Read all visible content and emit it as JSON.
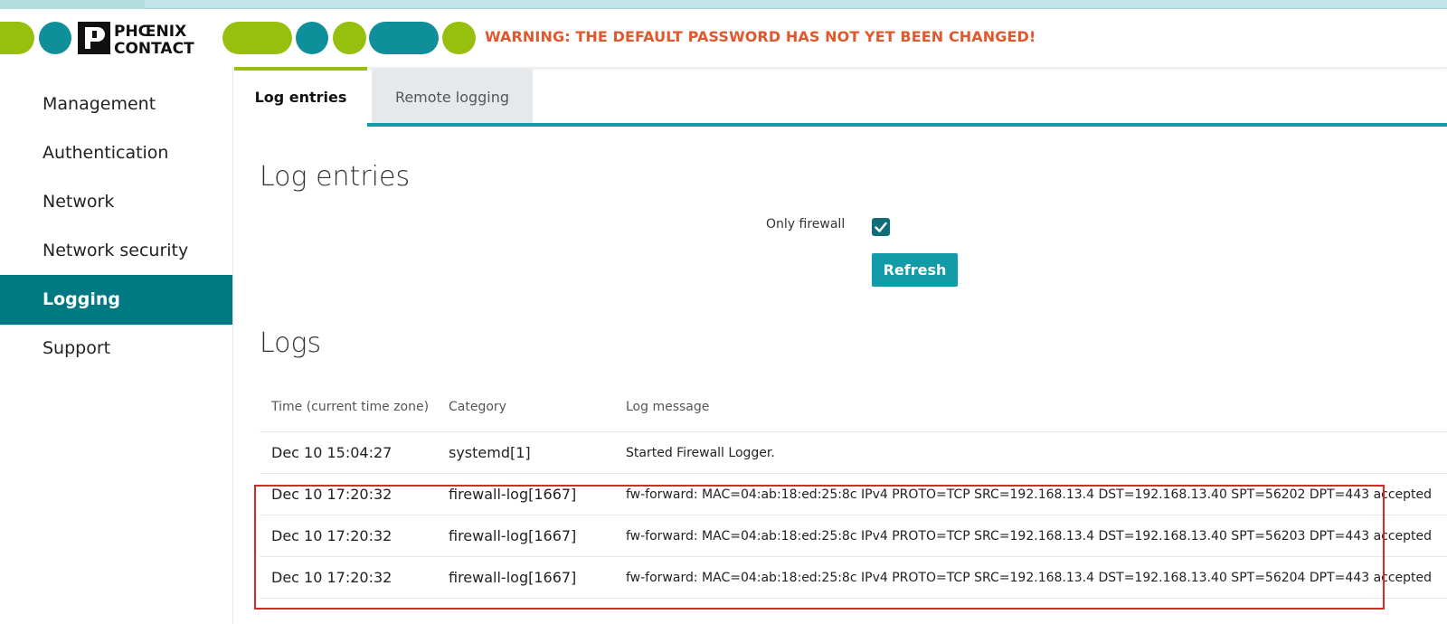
{
  "header": {
    "logo_text": "PHŒNIX CONTACT",
    "warning": "WARNING: THE DEFAULT PASSWORD HAS NOT YET BEEN CHANGED!",
    "colors": {
      "green": "#97bf0d",
      "teal": "#0f8f9a",
      "warning": "#e2572c"
    }
  },
  "sidebar": {
    "items": [
      {
        "label": "Management"
      },
      {
        "label": "Authentication"
      },
      {
        "label": "Network"
      },
      {
        "label": "Network security"
      },
      {
        "label": "Logging",
        "active": true
      },
      {
        "label": "Support"
      }
    ],
    "active_color": "#007983"
  },
  "tabs": [
    {
      "label": "Log entries",
      "active": true
    },
    {
      "label": "Remote logging",
      "active": false
    }
  ],
  "log_entries": {
    "title": "Log entries",
    "only_firewall_label": "Only firewall",
    "only_firewall_checked": true,
    "refresh_label": "Refresh"
  },
  "logs": {
    "title": "Logs",
    "columns": [
      "Time (current time zone)",
      "Category",
      "Log message"
    ],
    "rows": [
      {
        "time": "Dec 10 15:04:27",
        "category": "systemd[1]",
        "message": "Started Firewall Logger."
      },
      {
        "time": "Dec 10 17:20:32",
        "category": "firewall-log[1667]",
        "message": "fw-forward: MAC=04:ab:18:ed:25:8c IPv4 PROTO=TCP SRC=192.168.13.4 DST=192.168.13.40 SPT=56202 DPT=443 accepted"
      },
      {
        "time": "Dec 10 17:20:32",
        "category": "firewall-log[1667]",
        "message": "fw-forward: MAC=04:ab:18:ed:25:8c IPv4 PROTO=TCP SRC=192.168.13.4 DST=192.168.13.40 SPT=56203 DPT=443 accepted"
      },
      {
        "time": "Dec 10 17:20:32",
        "category": "firewall-log[1667]",
        "message": "fw-forward: MAC=04:ab:18:ed:25:8c IPv4 PROTO=TCP SRC=192.168.13.4 DST=192.168.13.40 SPT=56204 DPT=443 accepted"
      }
    ],
    "highlight_color": "#d42a2a"
  }
}
